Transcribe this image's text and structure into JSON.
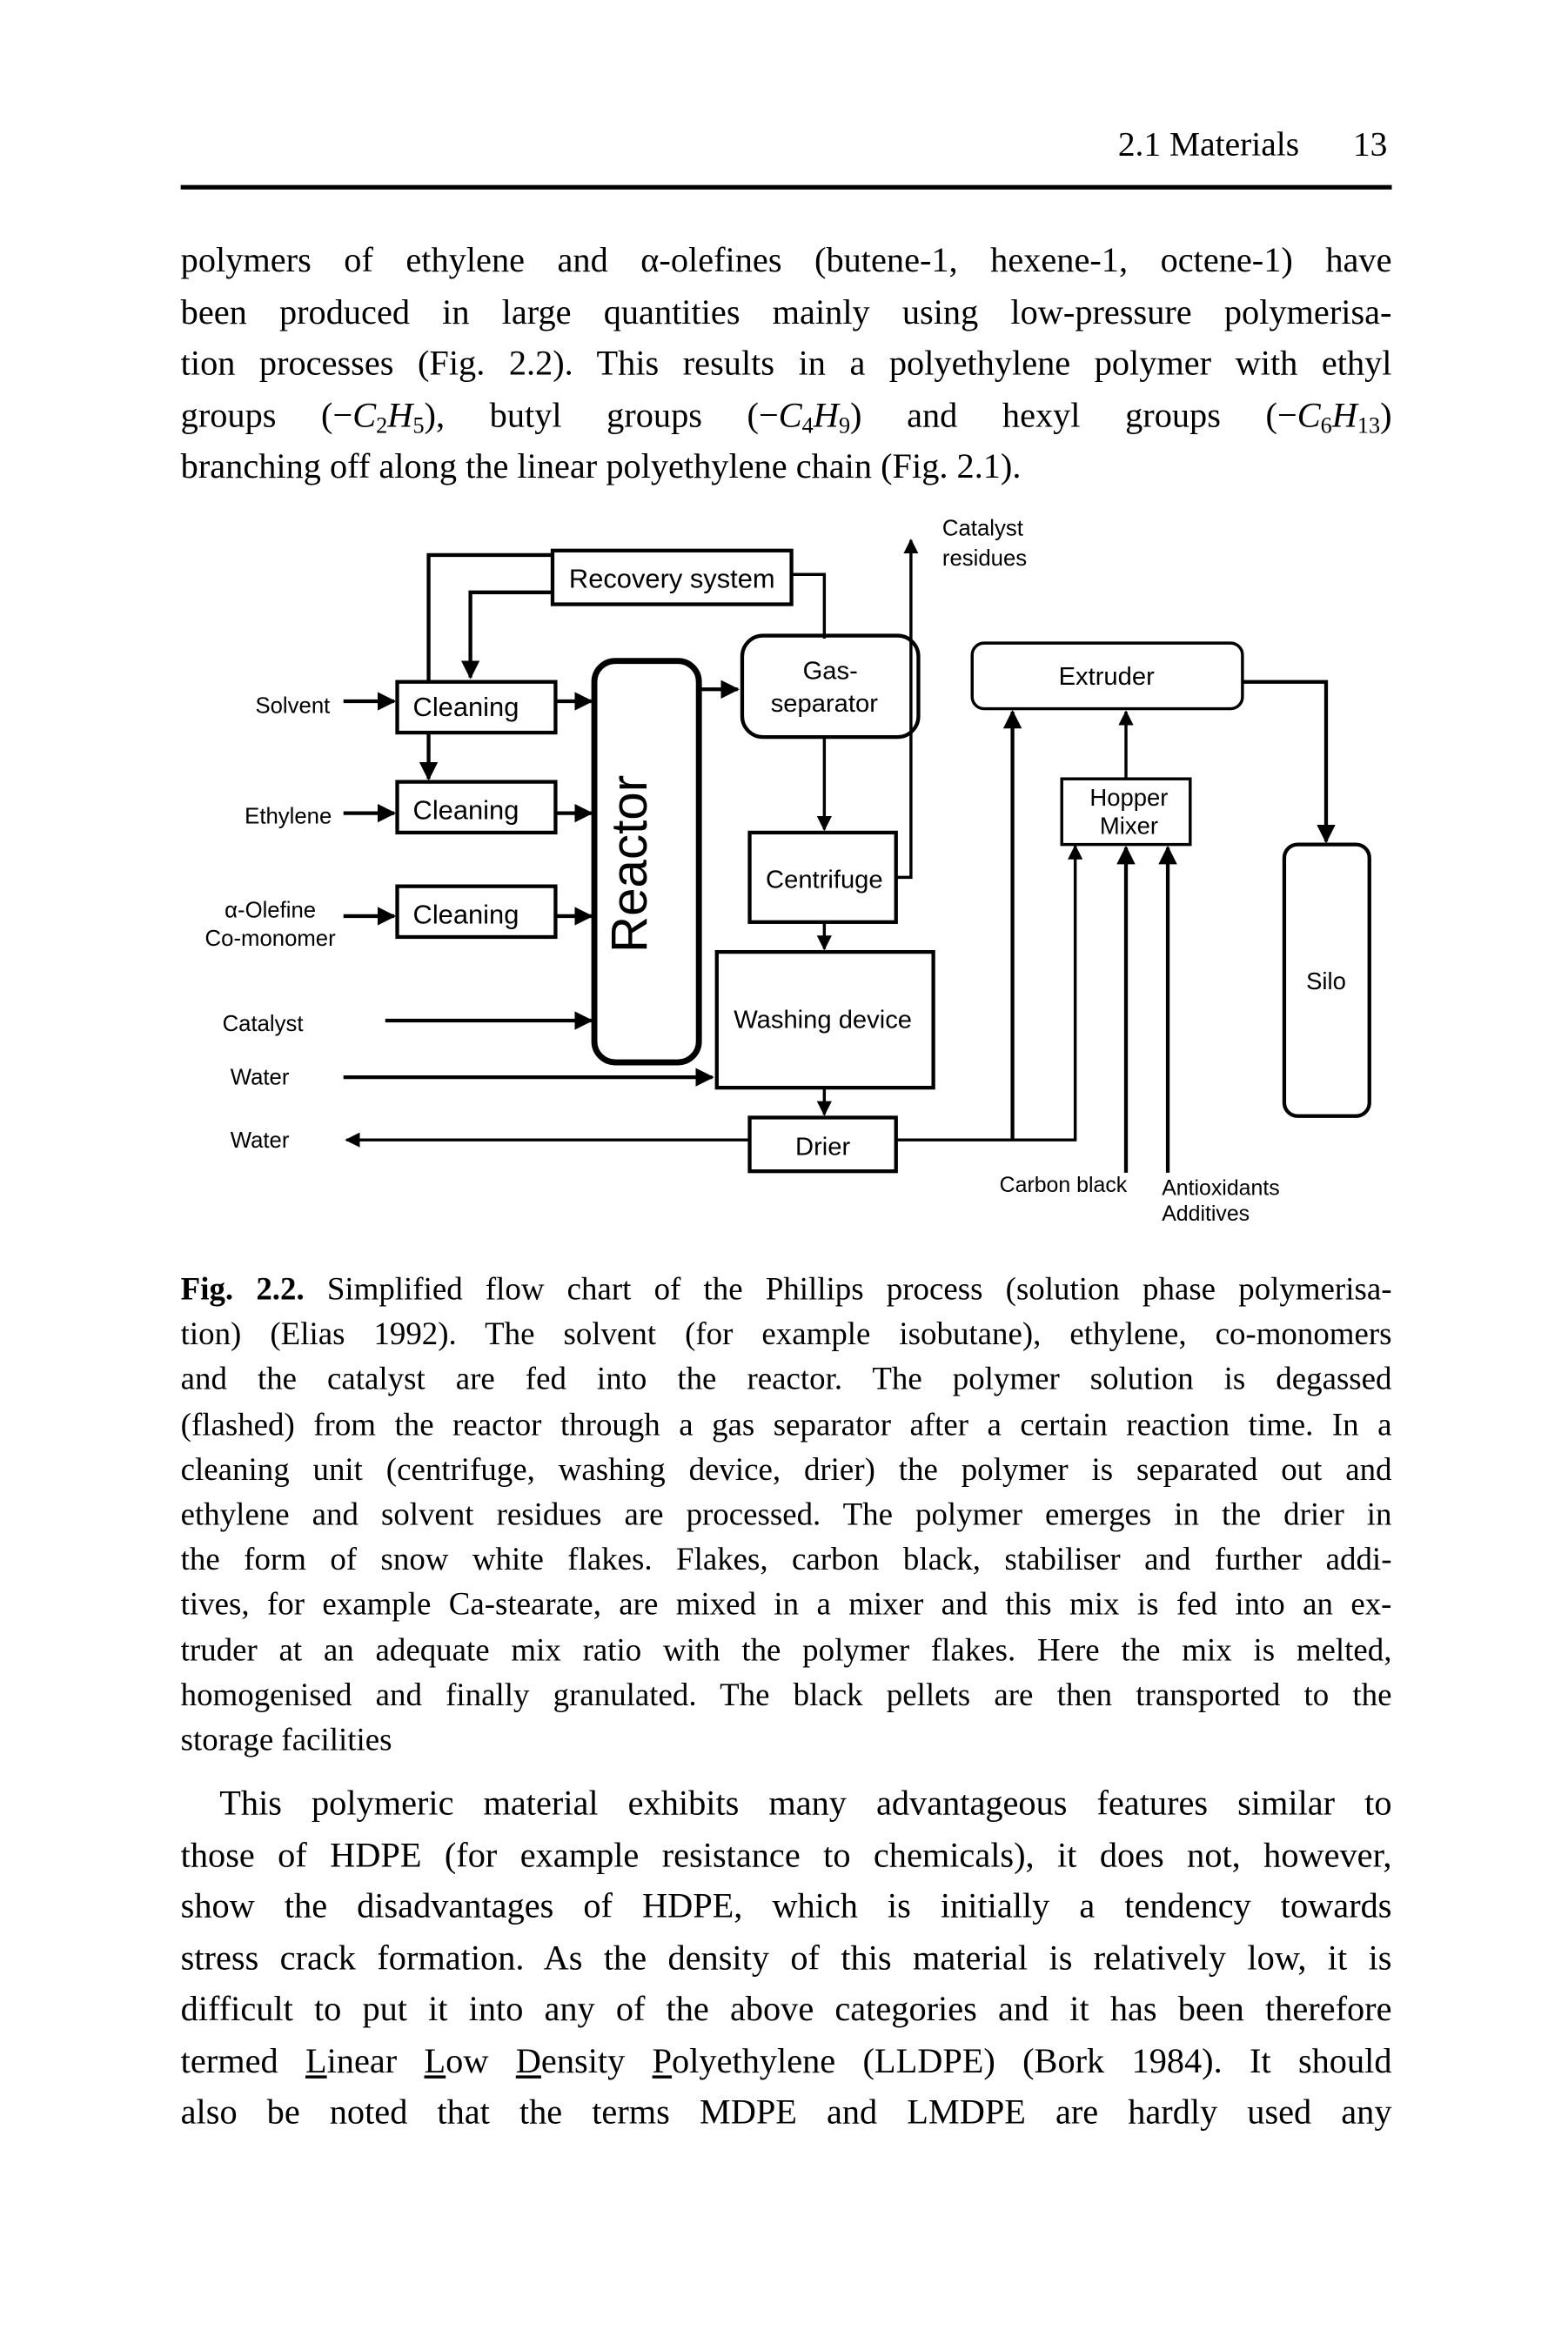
{
  "header": {
    "section": "2.1 Materials",
    "page_number": "13"
  },
  "paragraph1": {
    "lines": [
      "polymers of ethylene and α-olefines (butene-1, hexene-1, octene-1) have",
      "been produced in large quantities mainly using low-pressure polymerisa-",
      "tion processes (Fig. 2.2). This results in a polyethylene polymer with ethyl",
      "branching off along the linear polyethylene chain (Fig. 2.1)."
    ],
    "formula_line": {
      "t1": "groups (",
      "t2": "), butyl groups (",
      "t3": ") and hexyl groups (",
      "t4": ")",
      "f1": {
        "minus": "−",
        "c": "C",
        "cs": "2",
        "h": "H",
        "hs": "5"
      },
      "f2": {
        "minus": "−",
        "c": "C",
        "cs": "4",
        "h": "H",
        "hs": "9"
      },
      "f3": {
        "minus": "−",
        "c": "C",
        "cs": "6",
        "h": "H",
        "hs": "13"
      }
    }
  },
  "diagram": {
    "recovery_system": "Recovery system",
    "solvent": "Solvent",
    "ethylene": "Ethylene",
    "olefine_1": "α-Olefine",
    "olefine_2": "Co-monomer",
    "catalyst": "Catalyst",
    "water_in": "Water",
    "water_out": "Water",
    "cleaning_1": "Cleaning",
    "cleaning_2": "Cleaning",
    "cleaning_3": "Cleaning",
    "reactor": "Reactor",
    "gas_separator_1": "Gas-",
    "gas_separator_2": "separator",
    "centrifuge": "Centrifuge",
    "washing_device": "Washing device",
    "drier": "Drier",
    "catalyst_residues_1": "Catalyst",
    "catalyst_residues_2": "residues",
    "extruder": "Extruder",
    "hopper_1": "Hopper",
    "hopper_2": "Mixer",
    "silo": "Silo",
    "carbon_black": "Carbon black",
    "antioxidants": "Antioxidants",
    "additives": "Additives"
  },
  "caption": {
    "label": "Fig. 2.2.",
    "first_line_rest": " Simplified flow chart of the Phillips process (solution phase polymerisa-",
    "lines": [
      "tion) (Elias 1992). The solvent (for example isobutane), ethylene, co-monomers",
      "and the catalyst are fed into the reactor. The polymer solution is degassed",
      "(flashed) from the reactor through a gas separator after a certain reaction time. In a",
      "cleaning unit (centrifuge, washing device, drier) the polymer is separated out and",
      "ethylene and solvent residues are processed. The polymer emerges in the drier in",
      "the form of snow white flakes. Flakes, carbon black, stabiliser and further addi-",
      "tives, for example Ca-stearate, are mixed in a mixer and this mix is fed into an ex-",
      "truder at an adequate mix ratio with the polymer flakes. Here the mix is melted,",
      "homogenised and finally granulated. The black pellets are then transported to the",
      "storage facilities"
    ]
  },
  "paragraph2": {
    "lines": [
      "This polymeric material exhibits many advantageous features similar to",
      "those of HDPE (for example resistance to chemicals), it does not, however,",
      "show the disadvantages of HDPE, which is initially a tendency towards",
      "stress crack formation. As the density of this material is relatively low, it is",
      "difficult to put it into any of the above categories and it has been therefore"
    ],
    "lldpe_line": {
      "pre": "termed ",
      "L1": "L",
      "w1": "inear ",
      "L2": "L",
      "w2": "ow ",
      "D": "D",
      "w3": "ensity ",
      "P": "P",
      "w4": "olyethylene (LLDPE) (Bork 1984). It should"
    },
    "last_line": "also be noted that the terms MDPE and LMDPE are hardly used any"
  }
}
